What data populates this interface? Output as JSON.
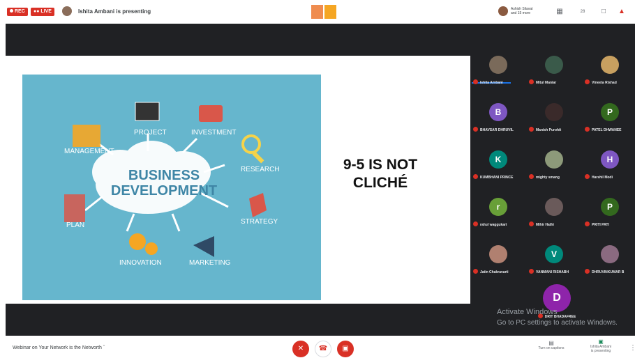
{
  "topbar": {
    "rec_label": "REC",
    "live_label": "LIVE",
    "presenting_text": "Ishita Ambani is presenting",
    "participants_summary_1": "Ashish Silavat",
    "participants_summary_2": "and 15 more",
    "count": "28"
  },
  "slide": {
    "title_line1": "9-5 IS NOT",
    "title_line2": "CLICHÉ",
    "center": "BUSINESS DEVELOPMENT",
    "labels": [
      "PROJECT",
      "INVESTMENT",
      "MANAGEMENT",
      "RESEARCH",
      "STRATEGY",
      "PLAN",
      "INNOVATION",
      "MARKETING"
    ]
  },
  "participants": [
    {
      "name": "Ishita Ambani",
      "initial": "",
      "color": "#7a6a5a"
    },
    {
      "name": "Mitul Maniar",
      "initial": "",
      "color": "#3a5a4a"
    },
    {
      "name": "Vineeta Rishad",
      "initial": "",
      "color": "#c8a060"
    },
    {
      "name": "BHAVSAR DHRUVIL",
      "initial": "B",
      "color": "#7e57c2"
    },
    {
      "name": "Manish Purohit",
      "initial": "",
      "color": "#3a2a2a"
    },
    {
      "name": "PATEL DHWANEE",
      "initial": "P",
      "color": "#33691e"
    },
    {
      "name": "KUMBHANI PRINCE",
      "initial": "K",
      "color": "#00897b"
    },
    {
      "name": "mighty smang",
      "initial": "",
      "color": "#8d9a7a"
    },
    {
      "name": "Harshil Modi",
      "initial": "H",
      "color": "#7e57c2"
    },
    {
      "name": "rahul waggukari",
      "initial": "r",
      "color": "#689f38"
    },
    {
      "name": "Mihir Hathi",
      "initial": "",
      "color": "#6a5a5a"
    },
    {
      "name": "PRITI PATI",
      "initial": "P",
      "color": "#33691e"
    },
    {
      "name": "Jatin Chakravarti",
      "initial": "",
      "color": "#b08070"
    },
    {
      "name": "VANMANI RISHABH",
      "initial": "V",
      "color": "#00897b"
    },
    {
      "name": "DHRUVINKUMAR B",
      "initial": "",
      "color": "#8a6a80"
    },
    {
      "name": "DRIT BHADAFREE",
      "initial": "D",
      "color": "#8e24aa"
    }
  ],
  "watermark": {
    "line1": "Activate Windows",
    "line2": "Go to PC settings to activate Windows."
  },
  "bottombar": {
    "meeting_title": "Webinar on Your Network is the Networth",
    "captions_label": "Turn on captions",
    "presenting_label_1": "Ishita Ambani",
    "presenting_label_2": "is presenting"
  },
  "colors": {
    "stage": "#202124",
    "slide_bg": "#66b6cd",
    "hangup": "#d93025"
  }
}
